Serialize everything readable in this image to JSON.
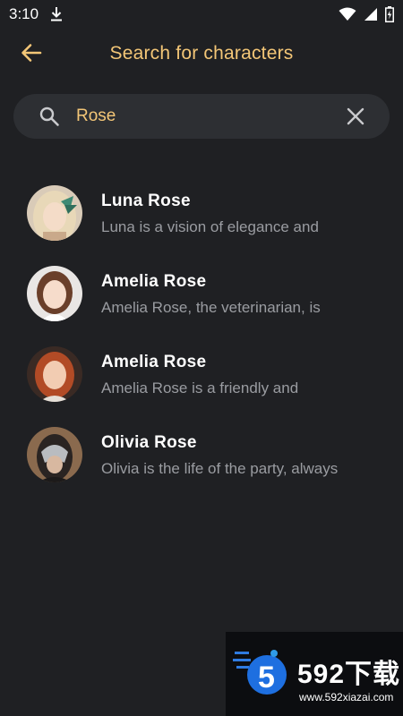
{
  "status_bar": {
    "time": "3:10"
  },
  "header": {
    "title": "Search for characters"
  },
  "search": {
    "value": "Rose"
  },
  "characters": [
    {
      "name": "Luna Rose",
      "description": "Luna is a vision of elegance and",
      "avatar": "green-accent-portrait"
    },
    {
      "name": "Amelia Rose",
      "description": "Amelia Rose, the veterinarian, is",
      "avatar": "brunette-portrait"
    },
    {
      "name": "Amelia Rose",
      "description": "Amelia Rose is a friendly and",
      "avatar": "redhead-portrait"
    },
    {
      "name": "Olivia Rose",
      "description": "Olivia is the life of the party, always",
      "avatar": "masked-portrait"
    }
  ],
  "watermark": {
    "brand": "592下载",
    "url": "www.592xiazai.com"
  },
  "colors": {
    "background": "#1f2023",
    "accent": "#f3c677",
    "search_bg": "#2d2f33",
    "secondary_text": "#9a9ca1"
  }
}
